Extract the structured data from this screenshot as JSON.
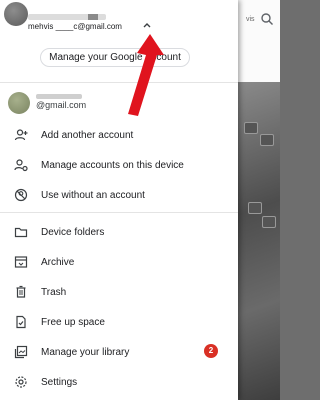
{
  "account": {
    "current_email": "mehvis ____c@gmail.com",
    "manage_label": "Manage your Google Account"
  },
  "other_account": {
    "email": "@gmail.com"
  },
  "account_menu": [
    {
      "label": "Add another account",
      "icon": "add-person-icon"
    },
    {
      "label": "Manage accounts on this device",
      "icon": "manage-accounts-icon"
    },
    {
      "label": "Use without an account",
      "icon": "no-account-icon"
    }
  ],
  "nav_menu": [
    {
      "label": "Device folders",
      "icon": "folder-icon"
    },
    {
      "label": "Archive",
      "icon": "archive-icon"
    },
    {
      "label": "Trash",
      "icon": "trash-icon"
    },
    {
      "label": "Free up space",
      "icon": "free-up-space-icon"
    },
    {
      "label": "Manage your library",
      "icon": "library-icon",
      "badge": "2"
    },
    {
      "label": "Settings",
      "icon": "gear-icon"
    }
  ],
  "background": {
    "partial_label": "vis"
  },
  "colors": {
    "badge": "#d93025",
    "annotation_arrow": "#e0141e"
  }
}
